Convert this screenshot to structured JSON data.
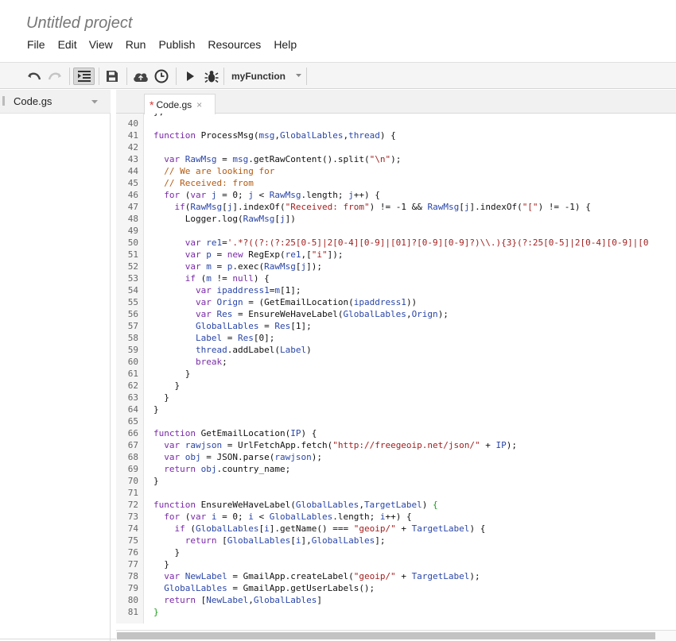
{
  "app": {
    "project_title": "Untitled project"
  },
  "menu": [
    "File",
    "Edit",
    "View",
    "Run",
    "Publish",
    "Resources",
    "Help"
  ],
  "toolbar": {
    "buttons": [
      "undo-icon",
      "redo-icon",
      "indent-icon",
      "save-icon",
      "cloud-icon",
      "clock-icon",
      "play-icon",
      "bug-icon"
    ],
    "function_select": "myFunction"
  },
  "sidebar": {
    "file_label": "Code.gs"
  },
  "editor": {
    "tab": {
      "dirty_marker": "*",
      "label": "Code.gs",
      "close": "×"
    },
    "partial_top_line": "};",
    "line_numbers": [
      "40",
      "41",
      "42",
      "43",
      "44",
      "45",
      "46",
      "47",
      "48",
      "49",
      "50",
      "51",
      "52",
      "53",
      "54",
      "55",
      "56",
      "57",
      "58",
      "59",
      "60",
      "61",
      "62",
      "63",
      "64",
      "65",
      "66",
      "67",
      "68",
      "69",
      "70",
      "71",
      "72",
      "73",
      "74",
      "75",
      "76",
      "77",
      "78",
      "79",
      "80",
      "81"
    ],
    "lines": [
      "",
      "function ProcessMsg(msg,GlobalLables,thread) {",
      "",
      "  var RawMsg = msg.getRawContent().split(\"\\n\");",
      "  // We are looking for",
      "  // Received: from",
      "  for (var j = 0; j < RawMsg.length; j++) {",
      "    if(RawMsg[j].indexOf(\"Received: from\") != -1 && RawMsg[j].indexOf(\"[\") != -1) {",
      "      Logger.log(RawMsg[j])",
      "",
      "      var re1='.*?((?:(?:25[0-5]|2[0-4][0-9]|[01]?[0-9][0-9]?)\\\\.){3}(?:25[0-5]|2[0-4][0-9]|[0",
      "      var p = new RegExp(re1,[\"i\"]);",
      "      var m = p.exec(RawMsg[j]);",
      "      if (m != null) {",
      "        var ipaddress1=m[1];",
      "        var Orign = (GetEmailLocation(ipaddress1))",
      "        var Res = EnsureWeHaveLabel(GlobalLables,Orign);",
      "        GlobalLables = Res[1];",
      "        Label = Res[0];",
      "        thread.addLabel(Label)",
      "        break;",
      "      }",
      "    }",
      "  }",
      "}",
      "",
      "function GetEmailLocation(IP) {",
      "  var rawjson = UrlFetchApp.fetch(\"http://freegeoip.net/json/\" + IP);",
      "  var obj = JSON.parse(rawjson);",
      "  return obj.country_name;",
      "}",
      "",
      "function EnsureWeHaveLabel(GlobalLables,TargetLabel) {",
      "  for (var i = 0; i < GlobalLables.length; i++) {",
      "    if (GlobalLables[i].getName() === \"geoip/\" + TargetLabel) {",
      "      return [GlobalLables[i],GlobalLables];",
      "    }",
      "  }",
      "  var NewLabel = GmailApp.createLabel(\"geoip/\" + TargetLabel);",
      "  GlobalLables = GmailApp.getUserLabels();",
      "  return [NewLabel,GlobalLables]",
      "}"
    ]
  },
  "colors": {
    "keyword": "#7a2aa8",
    "variable": "#2a46a8",
    "string": "#a32020",
    "comment": "#b35a12",
    "matched_brace": "#1b9a1b"
  }
}
